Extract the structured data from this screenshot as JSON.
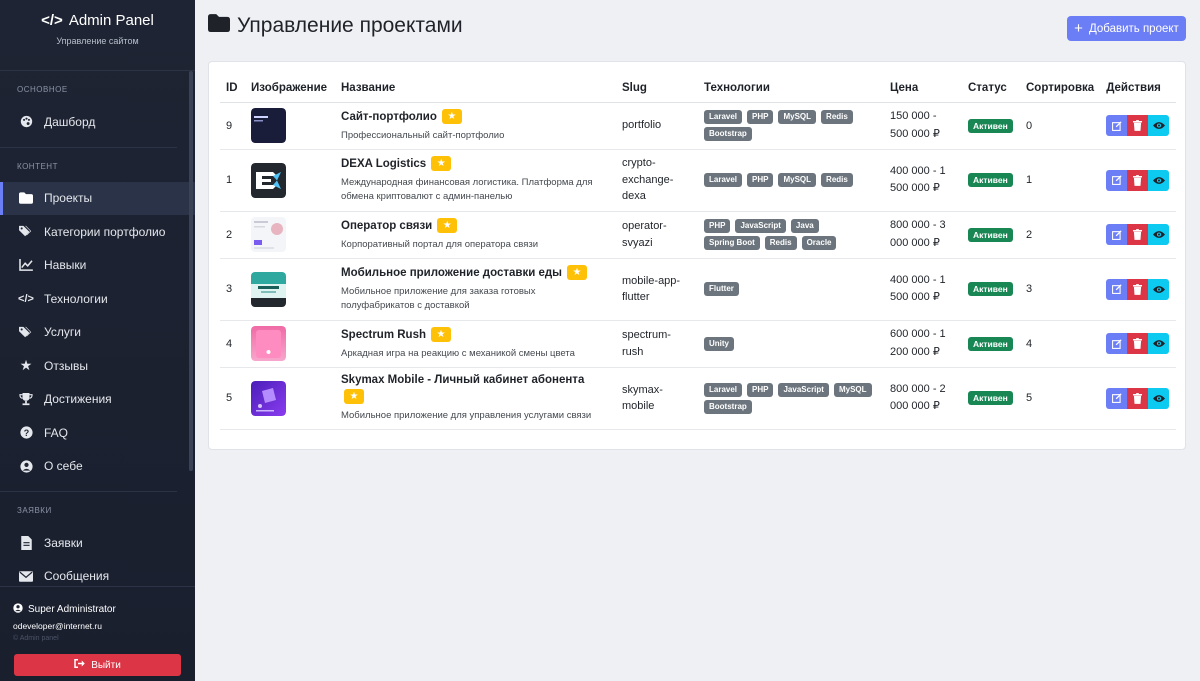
{
  "brand": {
    "title": "Admin Panel",
    "subtitle": "Управление сайтом"
  },
  "sidebar": {
    "sections": [
      {
        "label": "ОСНОВНОЕ"
      },
      {
        "label": "КОНТЕНТ"
      },
      {
        "label": "ЗАЯВКИ"
      }
    ],
    "items": [
      {
        "label": "Дашборд",
        "icon": "palette-icon"
      },
      {
        "label": "Проекты",
        "icon": "folder-icon",
        "active": true
      },
      {
        "label": "Категории портфолио",
        "icon": "tags-icon"
      },
      {
        "label": "Навыки",
        "icon": "chart-line-icon"
      },
      {
        "label": "Технологии",
        "icon": "code-icon"
      },
      {
        "label": "Услуги",
        "icon": "tags-icon"
      },
      {
        "label": "Отзывы",
        "icon": "star-icon"
      },
      {
        "label": "Достижения",
        "icon": "trophy-icon"
      },
      {
        "label": "FAQ",
        "icon": "question-icon"
      },
      {
        "label": "О себе",
        "icon": "user-icon"
      },
      {
        "label": "Заявки",
        "icon": "file-icon"
      },
      {
        "label": "Сообщения",
        "icon": "envelope-icon"
      }
    ]
  },
  "user": {
    "name": "Super Administrator",
    "email": "odeveloper@internet.ru",
    "faint": "© Admin panel",
    "logout_label": "Выйти"
  },
  "main": {
    "title": "Управление проектами",
    "add_label": "Добавить проект",
    "columns": [
      "ID",
      "Изображение",
      "Название",
      "Slug",
      "Технологии",
      "Цена",
      "Статус",
      "Сортировка",
      "Действия"
    ],
    "rows": [
      {
        "id": "9",
        "name": "Сайт-портфолио",
        "desc": "Профессиональный сайт-портфолио",
        "slug": "portfolio",
        "tags": [
          "Laravel",
          "PHP",
          "MySQL",
          "Redis",
          "Bootstrap"
        ],
        "price": "150 000 - 500 000 ₽",
        "status": "Активен",
        "sort": "0",
        "featured": true
      },
      {
        "id": "1",
        "name": "DEXA Logistics",
        "desc": "Международная финансовая логистика. Платформа для обмена криптовалют с админ-панелью",
        "slug": "crypto-exchange-dexa",
        "tags": [
          "Laravel",
          "PHP",
          "MySQL",
          "Redis"
        ],
        "price": "400 000 - 1 500 000 ₽",
        "status": "Активен",
        "sort": "1",
        "featured": true
      },
      {
        "id": "2",
        "name": "Оператор связи",
        "desc": "Корпоративный портал для оператора связи",
        "slug": "operator-svyazi",
        "tags": [
          "PHP",
          "JavaScript",
          "Java",
          "Spring Boot",
          "Redis",
          "Oracle"
        ],
        "price": "800 000 - 3 000 000 ₽",
        "status": "Активен",
        "sort": "2",
        "featured": true
      },
      {
        "id": "3",
        "name": "Мобильное приложение доставки еды",
        "desc": "Мобильное приложение для заказа готовых полуфабрикатов с доставкой",
        "slug": "mobile-app-flutter",
        "tags": [
          "Flutter"
        ],
        "price": "400 000 - 1 500 000 ₽",
        "status": "Активен",
        "sort": "3",
        "featured": true
      },
      {
        "id": "4",
        "name": "Spectrum Rush",
        "desc": "Аркадная игра на реакцию с механикой смены цвета",
        "slug": "spectrum-rush",
        "tags": [
          "Unity"
        ],
        "price": "600 000 - 1 200 000 ₽",
        "status": "Активен",
        "sort": "4",
        "featured": true
      },
      {
        "id": "5",
        "name": "Skymax Mobile - Личный кабинет абонента",
        "desc": "Мобильное приложение для управления услугами связи",
        "slug": "skymax-mobile",
        "tags": [
          "Laravel",
          "PHP",
          "JavaScript",
          "MySQL",
          "Bootstrap"
        ],
        "price": "800 000 - 2 000 000 ₽",
        "status": "Активен",
        "sort": "5",
        "featured": true
      }
    ]
  },
  "colors": {
    "accent": "#6c7ef5",
    "danger": "#dc3545",
    "info": "#0dcaf0",
    "success": "#198754",
    "warning": "#ffc107",
    "tag": "#6c757d",
    "sidebar": "#1e2433"
  }
}
